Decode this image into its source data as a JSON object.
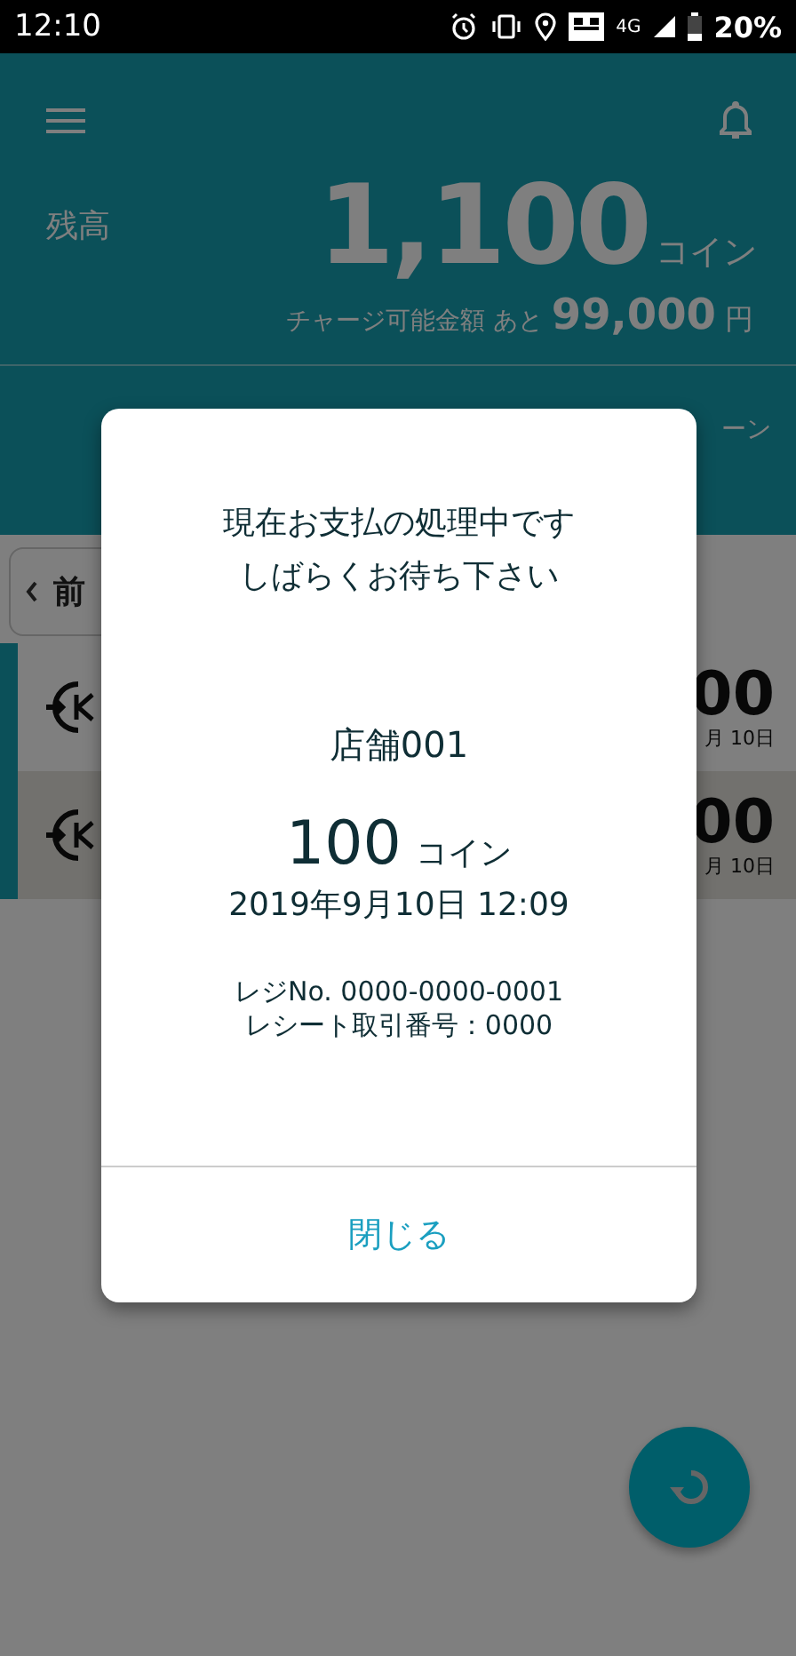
{
  "status_bar": {
    "time": "12:10",
    "network": "4G",
    "battery": "20%"
  },
  "header": {
    "balance_label": "残高",
    "balance": "1,100",
    "balance_unit": "コイン",
    "charge_label": "チャージ可能金額 あと",
    "charge_amount": "99,000",
    "charge_unit": "円"
  },
  "tab_partial": "ーン",
  "prev_button": {
    "label": "前"
  },
  "history": [
    {
      "amount": "00",
      "date": "月 10日",
      "selected": false
    },
    {
      "amount": "00",
      "date": "月 10日",
      "selected": true
    }
  ],
  "dialog": {
    "message": [
      "現在お支払の処理中です",
      "しばらくお待ち下さい"
    ],
    "store": "店舗001",
    "amount": "100",
    "unit": "コイン",
    "datetime": "2019年9月10日 12:09",
    "register": "レジNo. 0000-0000-0001",
    "receipt": "レシート取引番号：0000",
    "close_button": "閉じる"
  }
}
